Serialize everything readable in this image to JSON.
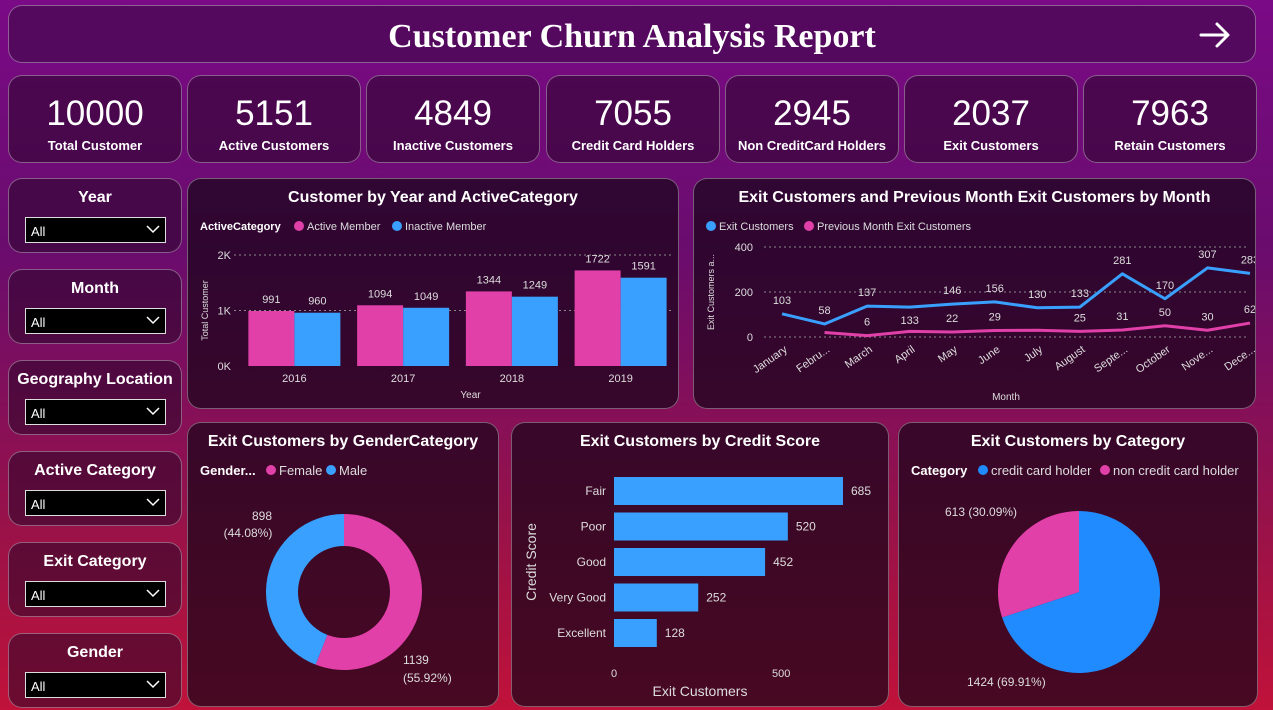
{
  "header": {
    "title": "Customer Churn Analysis Report",
    "nav_icon": "arrow-right-icon"
  },
  "kpis": [
    {
      "value": "10000",
      "label": "Total Customer"
    },
    {
      "value": "5151",
      "label": "Active Customers"
    },
    {
      "value": "4849",
      "label": "Inactive Customers"
    },
    {
      "value": "7055",
      "label": "Credit Card Holders"
    },
    {
      "value": "2945",
      "label": "Non CreditCard Holders"
    },
    {
      "value": "2037",
      "label": "Exit Customers"
    },
    {
      "value": "7963",
      "label": "Retain Customers"
    }
  ],
  "filters": [
    {
      "label": "Year",
      "value": "All"
    },
    {
      "label": "Month",
      "value": "All"
    },
    {
      "label": "Geography Location",
      "value": "All"
    },
    {
      "label": "Active Category",
      "value": "All"
    },
    {
      "label": "Exit Category",
      "value": "All"
    },
    {
      "label": "Gender",
      "value": "All"
    }
  ],
  "colors": {
    "pink": "#e040a8",
    "blue": "#3aa0ff"
  },
  "chart_data": [
    {
      "type": "bar",
      "title": "Customer by Year and ActiveCategory",
      "legend_title": "ActiveCategory",
      "categories": [
        "2016",
        "2017",
        "2018",
        "2019"
      ],
      "series": [
        {
          "name": "Active Member",
          "values": [
            991,
            1094,
            1344,
            1722
          ],
          "color": "#e040a8"
        },
        {
          "name": "Inactive Member",
          "values": [
            960,
            1049,
            1249,
            1591
          ],
          "color": "#3aa0ff"
        }
      ],
      "yticks": [
        "0K",
        "1K",
        "2K"
      ],
      "xlabel": "Year",
      "ylabel": "Total Customer",
      "ylim": [
        0,
        2000
      ]
    },
    {
      "type": "line",
      "title": "Exit Customers and Previous Month Exit Customers by Month",
      "categories": [
        "January",
        "Febru...",
        "March",
        "April",
        "May",
        "June",
        "July",
        "August",
        "Septe...",
        "October",
        "Nove...",
        "Dece..."
      ],
      "series": [
        {
          "name": "Exit Customers",
          "values": [
            103,
            58,
            137,
            133,
            146,
            156,
            130,
            133,
            281,
            170,
            307,
            283
          ],
          "color": "#3aa0ff"
        },
        {
          "name": "Previous Month Exit Customers",
          "values": [
            null,
            20,
            6,
            25,
            22,
            29,
            30,
            25,
            31,
            50,
            30,
            62
          ],
          "color": "#e040a8"
        }
      ],
      "labels": {
        "blue": [
          "103",
          "58",
          "137",
          "",
          "146",
          "156",
          "130",
          "133",
          "281",
          "170",
          "307",
          "283"
        ],
        "pink": [
          "",
          "",
          "6",
          "133",
          "22",
          "29",
          "",
          "25",
          "31",
          "50",
          "30",
          "62"
        ]
      },
      "yticks": [
        "0",
        "200",
        "400"
      ],
      "xlabel": "Month",
      "ylabel": "Exit Customers a...",
      "ylim": [
        0,
        400
      ]
    },
    {
      "type": "pie",
      "title": "Exit Customers by GenderCategory",
      "legend_title": "Gender...",
      "slices": [
        {
          "name": "Female",
          "value": 1139,
          "pct": "55.92%",
          "color": "#e040a8"
        },
        {
          "name": "Male",
          "value": 898,
          "pct": "44.08%",
          "color": "#3aa0ff"
        }
      ],
      "donut": true
    },
    {
      "type": "bar",
      "orientation": "horizontal",
      "title": "Exit Customers by Credit Score",
      "categories": [
        "Fair",
        "Poor",
        "Good",
        "Very Good",
        "Excellent"
      ],
      "values": [
        685,
        520,
        452,
        252,
        128
      ],
      "xticks": [
        "0",
        "500"
      ],
      "xlabel": "Exit Customers",
      "ylabel": "Credit Score",
      "xlim": [
        0,
        700
      ]
    },
    {
      "type": "pie",
      "title": "Exit Customers by Category",
      "legend_title": "Category",
      "slices": [
        {
          "name": "credit card holder",
          "value": 1424,
          "pct": "69.91%",
          "color": "#1f8bff"
        },
        {
          "name": "non credit card holder",
          "value": 613,
          "pct": "30.09%",
          "color": "#e040a8"
        }
      ]
    }
  ]
}
